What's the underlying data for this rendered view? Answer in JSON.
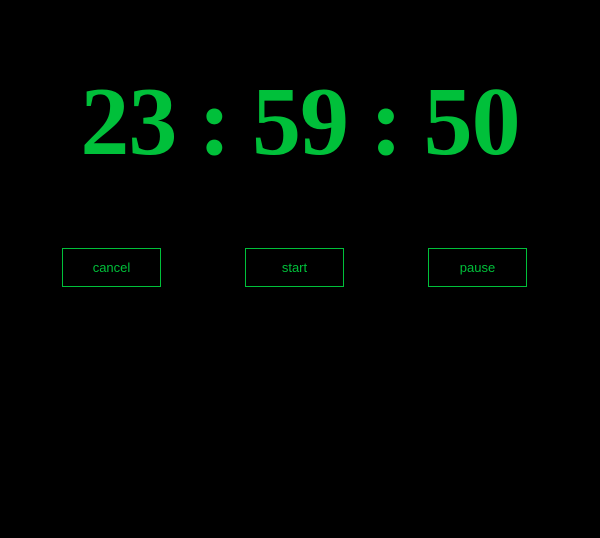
{
  "timer": {
    "hours": "23",
    "minutes": "59",
    "seconds": "50",
    "separator": ":"
  },
  "buttons": {
    "cancel_label": "cancel",
    "start_label": "start",
    "pause_label": "pause"
  },
  "colors": {
    "background": "#000000",
    "accent": "#00c03a"
  }
}
